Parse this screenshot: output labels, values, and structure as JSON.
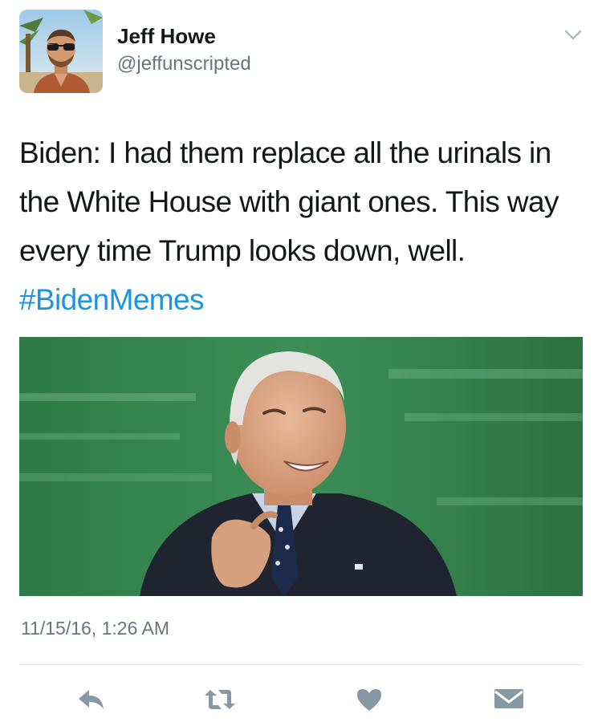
{
  "author": {
    "display_name": "Jeff Howe",
    "handle": "@jeffunscripted",
    "avatar": "profile-photo"
  },
  "tweet": {
    "text": "Biden: I had them replace all the urinals in the White House with giant ones. This way every time Trump looks down, well.",
    "hashtag": "#BidenMemes",
    "media": "photo-of-man-in-suit-smiling-pinching-fingers",
    "timestamp": "11/15/16, 1:26 AM"
  },
  "actions": [
    {
      "icon": "reply-icon"
    },
    {
      "icon": "retweet-icon"
    },
    {
      "icon": "heart-icon"
    },
    {
      "icon": "direct-message-icon"
    }
  ],
  "colors": {
    "link": "#1b95e0",
    "icon": "#8899a6",
    "secondary_text": "#66757f",
    "divider": "#e1e8ed"
  }
}
